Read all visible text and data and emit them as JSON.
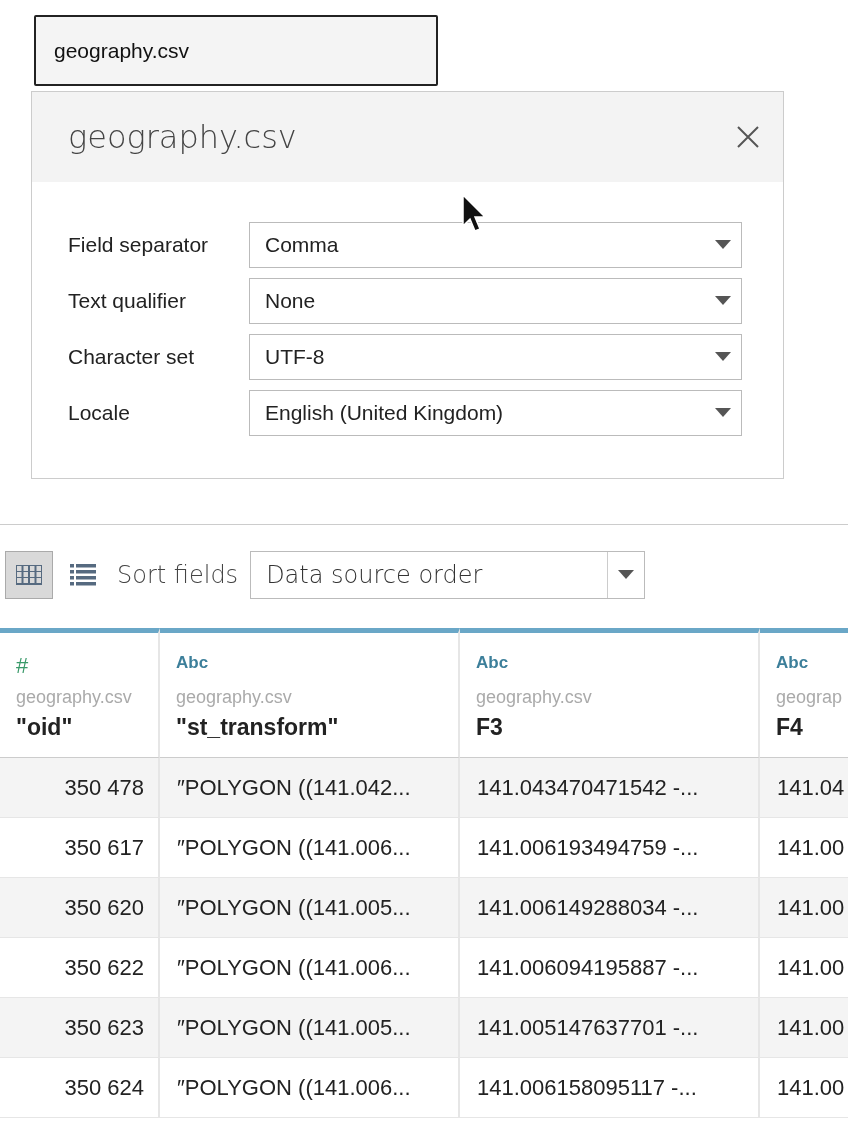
{
  "file_tab": {
    "label": "geography.csv"
  },
  "dialog": {
    "title": "geography.csv",
    "fields": [
      {
        "label": "Field separator",
        "value": "Comma"
      },
      {
        "label": "Text qualifier",
        "value": "None"
      },
      {
        "label": "Character set",
        "value": "UTF-8"
      },
      {
        "label": "Locale",
        "value": "English (United Kingdom)"
      }
    ]
  },
  "toolbar": {
    "views": [
      {
        "kind": "grid",
        "selected": true
      },
      {
        "kind": "list",
        "selected": false
      }
    ],
    "sort_label": "Sort fields",
    "sort_value": "Data source order"
  },
  "table": {
    "columns": [
      {
        "kind": "number",
        "type_label": "#",
        "source": "geography.csv",
        "name": "\"oid\""
      },
      {
        "kind": "string",
        "type_label": "Abc",
        "source": "geography.csv",
        "name": "\"st_transform\""
      },
      {
        "kind": "string",
        "type_label": "Abc",
        "source": "geography.csv",
        "name": "F3"
      },
      {
        "kind": "string",
        "type_label": "Abc",
        "source": "geograp",
        "name": "F4"
      }
    ],
    "rows": [
      [
        "350 478",
        "″POLYGON ((141.042...",
        "141.043470471542 -...",
        "141.04"
      ],
      [
        "350 617",
        "″POLYGON ((141.006...",
        "141.006193494759 -...",
        "141.00"
      ],
      [
        "350 620",
        "″POLYGON ((141.005...",
        "141.006149288034 -...",
        "141.00"
      ],
      [
        "350 622",
        "″POLYGON ((141.006...",
        "141.006094195887 -...",
        "141.00"
      ],
      [
        "350 623",
        "″POLYGON ((141.005...",
        "141.005147637701 -...",
        "141.00"
      ],
      [
        "350 624",
        "″POLYGON ((141.006...",
        "141.006158095117 -...",
        "141.00"
      ]
    ]
  }
}
